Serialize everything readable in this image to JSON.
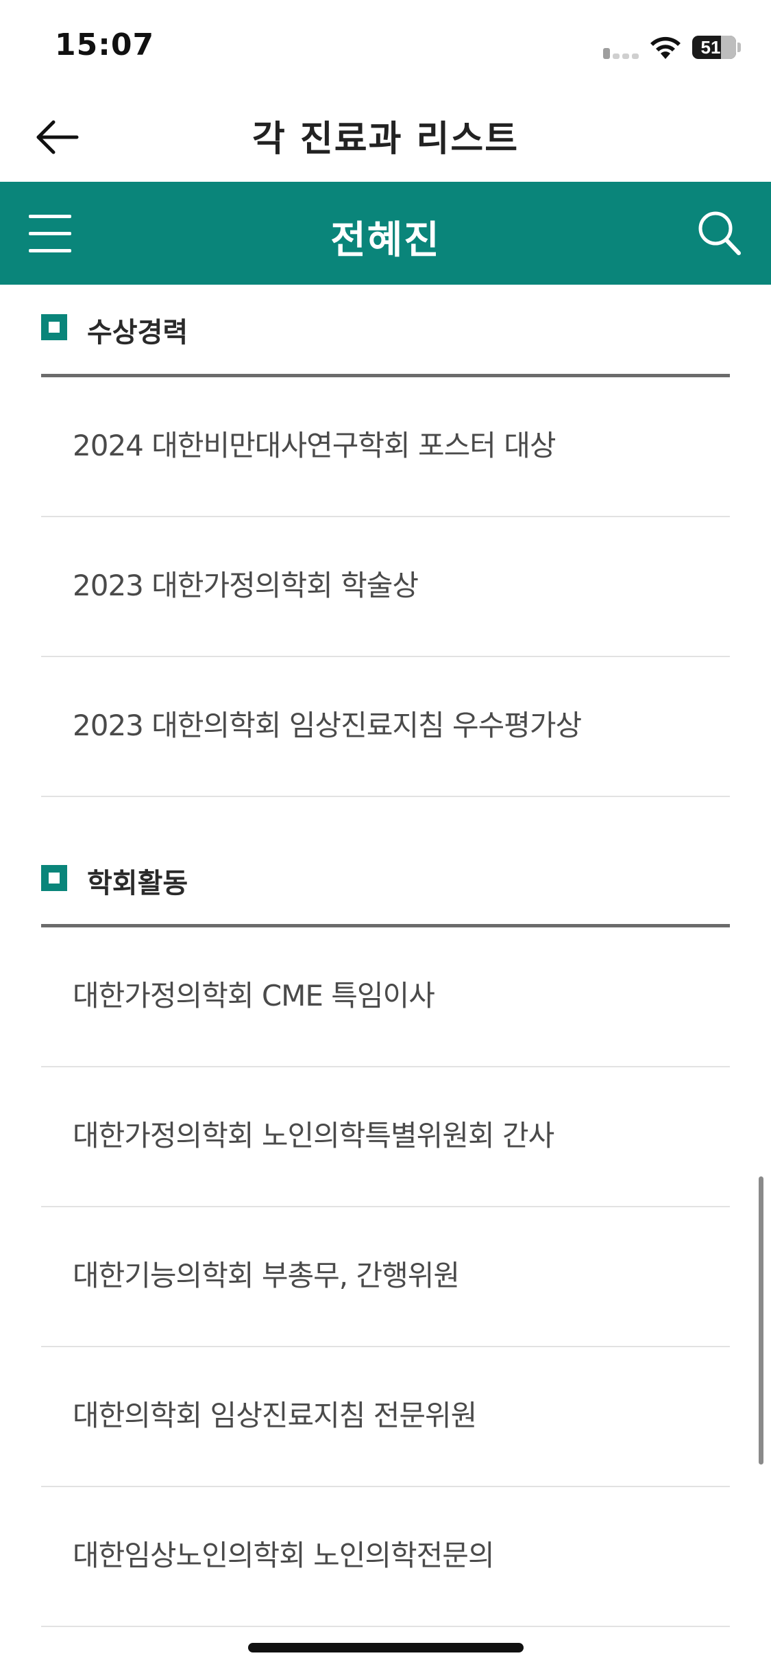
{
  "status_bar": {
    "time": "15:07",
    "battery": "51"
  },
  "header": {
    "title": "각 진료과 리스트",
    "back_icon": "arrow-left-icon"
  },
  "green_bar": {
    "doctor_name": "전혜진",
    "menu_icon": "hamburger-menu-icon",
    "search_icon": "search-icon",
    "accent_color": "#0a857a"
  },
  "sections": [
    {
      "title": "수상경력",
      "items": [
        "2024 대한비만대사연구학회 포스터 대상",
        "2023 대한가정의학회 학술상",
        "2023 대한의학회 임상진료지침 우수평가상"
      ]
    },
    {
      "title": "학회활동",
      "items": [
        "대한가정의학회 CME 특임이사",
        "대한가정의학회 노인의학특별위원회 간사",
        "대한기능의학회 부총무, 간행위원",
        "대한의학회 임상진료지침 전문위원",
        "대한임상노인의학회 노인의학전문의"
      ]
    }
  ]
}
